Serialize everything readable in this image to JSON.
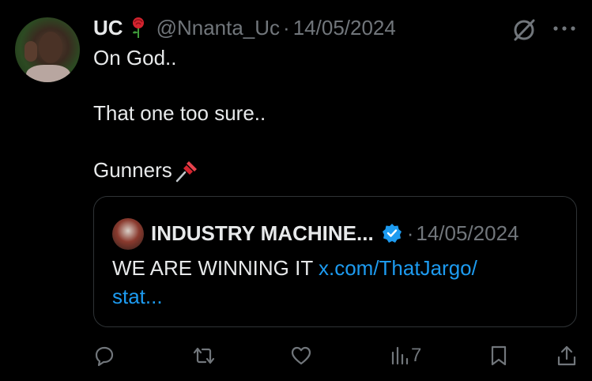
{
  "post": {
    "display_name": "UC",
    "handle": "@Nnanta_Uc",
    "separator": "·",
    "date": "14/05/2024",
    "lines": [
      "On God..",
      "That one too sure..",
      "Gunners"
    ]
  },
  "quote": {
    "display_name": "INDUSTRY MACHINE...",
    "separator": "·",
    "date": "14/05/2024",
    "text": "WE ARE WINNING IT ",
    "link_text": "x.com/ThatJargo/",
    "link_text_2": "stat..."
  },
  "actions": {
    "views": "7"
  },
  "icons": {
    "rose": "rose-emoji-icon",
    "pushpin": "pushpin-emoji-icon",
    "grok": "grok-icon",
    "more": "more-icon",
    "verified": "verified-badge-icon",
    "reply": "reply-icon",
    "repost": "repost-icon",
    "like": "like-icon",
    "views": "views-icon",
    "bookmark": "bookmark-icon",
    "share": "share-icon"
  },
  "colors": {
    "background": "#000000",
    "text": "#e7e9ea",
    "muted": "#71767b",
    "link": "#1d9bf0",
    "border": "#2f3336"
  }
}
